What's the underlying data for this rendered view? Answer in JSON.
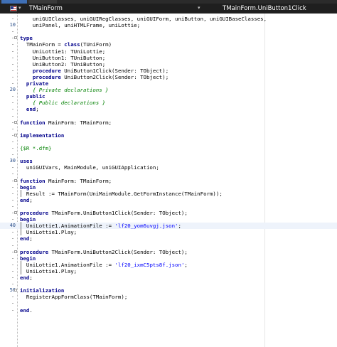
{
  "toolbar": {
    "unit_name": "TMainForm",
    "method_name": "TMainForm.UniButton1Click",
    "flag_icon": "flag-icon",
    "dropdown_icon": "chevron-down-icon"
  },
  "editor": {
    "lines": [
      {
        "n": "",
        "segs": [
          [
            "    uniGUIClasses, uniGUIRegClasses, uniGUIForm, uniButton, uniGUIBaseClasses,",
            ""
          ]
        ]
      },
      {
        "n": "10",
        "segs": [
          [
            "    uniPanel, uniHTMLFrame, uniLottie;",
            ""
          ]
        ]
      },
      {
        "n": "",
        "segs": []
      },
      {
        "n": "",
        "segs": [
          [
            "type",
            "kw"
          ]
        ]
      },
      {
        "n": "",
        "segs": [
          [
            "  TMainForm = ",
            ""
          ],
          [
            "class",
            "kw"
          ],
          [
            "(TUniForm)",
            ""
          ]
        ]
      },
      {
        "n": "",
        "segs": [
          [
            "    UniLottie1: TUniLottie;",
            ""
          ]
        ]
      },
      {
        "n": "",
        "segs": [
          [
            "    UniButton1: TUniButton;",
            ""
          ]
        ]
      },
      {
        "n": "",
        "segs": [
          [
            "    UniButton2: TUniButton;",
            ""
          ]
        ]
      },
      {
        "n": "",
        "segs": [
          [
            "    ",
            ""
          ],
          [
            "procedure",
            "kw"
          ],
          [
            " UniButton1Click(Sender: TObject);",
            ""
          ]
        ]
      },
      {
        "n": "",
        "segs": [
          [
            "    ",
            ""
          ],
          [
            "procedure",
            "kw"
          ],
          [
            " UniButton2Click(Sender: TObject);",
            ""
          ]
        ]
      },
      {
        "n": "",
        "segs": [
          [
            "  ",
            ""
          ],
          [
            "private",
            "kw"
          ]
        ]
      },
      {
        "n": "20",
        "segs": [
          [
            "    ",
            ""
          ],
          [
            "{ Private declarations }",
            "cm"
          ]
        ]
      },
      {
        "n": "",
        "segs": [
          [
            "  ",
            ""
          ],
          [
            "public",
            "kw"
          ]
        ]
      },
      {
        "n": "",
        "segs": [
          [
            "    ",
            ""
          ],
          [
            "{ Public declarations }",
            "cm"
          ]
        ]
      },
      {
        "n": "",
        "segs": [
          [
            "  ",
            ""
          ],
          [
            "end",
            "kw"
          ],
          [
            ";",
            ""
          ]
        ]
      },
      {
        "n": "",
        "segs": []
      },
      {
        "n": "",
        "segs": [
          [
            "function",
            "kw"
          ],
          [
            " MainForm: TMainForm;",
            ""
          ]
        ]
      },
      {
        "n": "",
        "segs": []
      },
      {
        "n": "",
        "segs": [
          [
            "implementation",
            "kw"
          ]
        ]
      },
      {
        "n": "",
        "segs": []
      },
      {
        "n": "",
        "segs": [
          [
            "{$R *.dfm}",
            "dir"
          ]
        ]
      },
      {
        "n": "",
        "segs": []
      },
      {
        "n": "30",
        "segs": [
          [
            "uses",
            "kw"
          ]
        ]
      },
      {
        "n": "",
        "segs": [
          [
            "  uniGUIVars, MainModule, uniGUIApplication;",
            ""
          ]
        ]
      },
      {
        "n": "",
        "segs": []
      },
      {
        "n": "",
        "segs": [
          [
            "function",
            "kw"
          ],
          [
            " MainForm: TMainForm;",
            ""
          ]
        ]
      },
      {
        "n": "",
        "segs": [
          [
            "begin",
            "kw"
          ]
        ]
      },
      {
        "n": "",
        "segs": [
          [
            "  Result := TMainForm(UniMainModule.GetFormInstance(TMainForm));",
            ""
          ]
        ]
      },
      {
        "n": "",
        "segs": [
          [
            "end",
            "kw"
          ],
          [
            ";",
            ""
          ]
        ]
      },
      {
        "n": "",
        "segs": []
      },
      {
        "n": "",
        "segs": [
          [
            "procedure",
            "kw"
          ],
          [
            " TMainForm.UniButton1Click(Sender: TObject);",
            ""
          ]
        ]
      },
      {
        "n": "",
        "segs": [
          [
            "begin",
            "kw"
          ]
        ]
      },
      {
        "n": "40",
        "segs": [
          [
            "  UniLottie1.AnimationFile := ",
            ""
          ],
          [
            "'lf20_yom6uvgj.json'",
            "str"
          ],
          [
            ";",
            ""
          ]
        ]
      },
      {
        "n": "",
        "segs": [
          [
            "  UniLottie1.Play;",
            ""
          ]
        ]
      },
      {
        "n": "",
        "segs": [
          [
            "end",
            "kw"
          ],
          [
            ";",
            ""
          ]
        ]
      },
      {
        "n": "",
        "segs": []
      },
      {
        "n": "",
        "segs": [
          [
            "procedure",
            "kw"
          ],
          [
            " TMainForm.UniButton2Click(Sender: TObject);",
            ""
          ]
        ]
      },
      {
        "n": "",
        "segs": [
          [
            "begin",
            "kw"
          ]
        ]
      },
      {
        "n": "",
        "segs": [
          [
            "  UniLottie1.AnimationFile := ",
            ""
          ],
          [
            "'lf20_ixmC5pts8f.json'",
            "str"
          ],
          [
            ";",
            ""
          ]
        ]
      },
      {
        "n": "",
        "segs": [
          [
            "  UniLottie1.Play;",
            ""
          ]
        ]
      },
      {
        "n": "",
        "segs": [
          [
            "end",
            "kw"
          ],
          [
            ";",
            ""
          ]
        ]
      },
      {
        "n": "",
        "segs": []
      },
      {
        "n": "50",
        "segs": [
          [
            "initialization",
            "kw"
          ]
        ]
      },
      {
        "n": "",
        "segs": [
          [
            "  RegisterAppFormClass(TMainForm);",
            ""
          ]
        ]
      },
      {
        "n": "",
        "segs": []
      },
      {
        "n": "",
        "segs": [
          [
            "end",
            "kw"
          ],
          [
            ".",
            ""
          ]
        ]
      }
    ]
  },
  "colors": {
    "keyword": "#00008b",
    "string": "#0000ff",
    "comment": "#008000",
    "toolbar_bg": "#1f1f1f"
  }
}
